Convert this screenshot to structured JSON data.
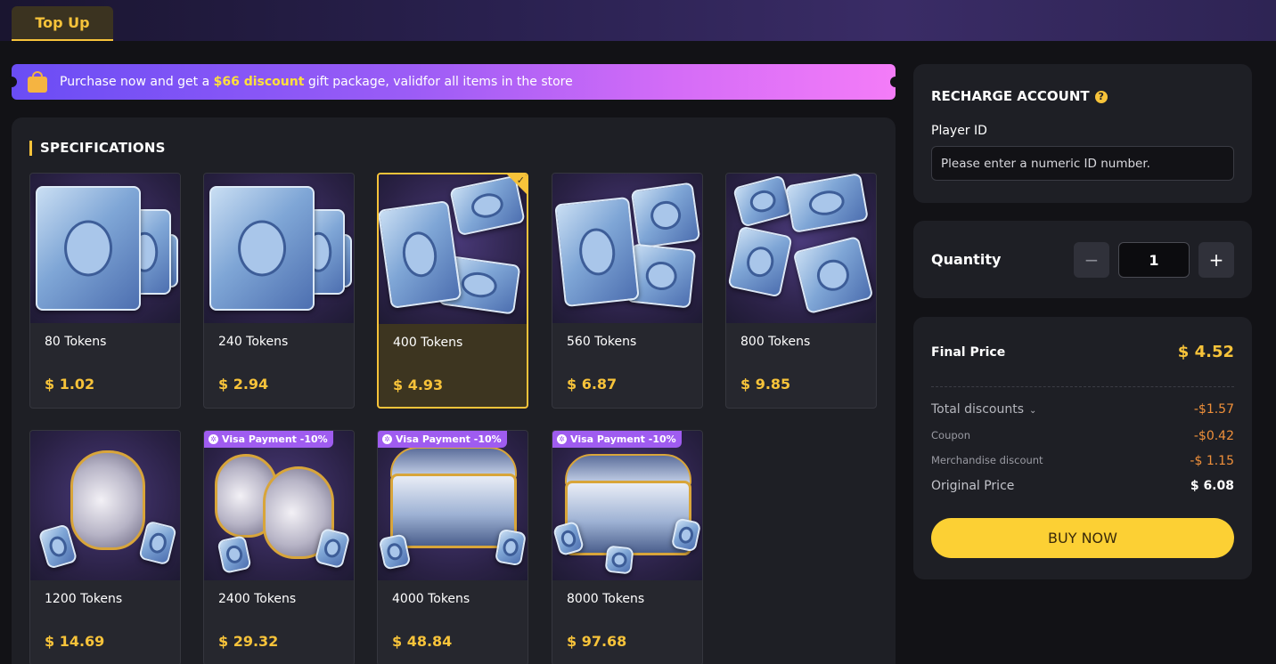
{
  "header": {
    "tab_label": "Top Up"
  },
  "banner": {
    "text_before": "Purchase now and get a ",
    "highlight": "$66 discount",
    "text_after": " gift package, validfor all items in the store"
  },
  "specs": {
    "title": "SPECIFICATIONS",
    "items": [
      {
        "name": "80 Tokens",
        "price": "$ 1.02",
        "selected": false,
        "badge": ""
      },
      {
        "name": "240 Tokens",
        "price": "$ 2.94",
        "selected": false,
        "badge": ""
      },
      {
        "name": "400 Tokens",
        "price": "$ 4.93",
        "selected": true,
        "badge": ""
      },
      {
        "name": "560 Tokens",
        "price": "$ 6.87",
        "selected": false,
        "badge": ""
      },
      {
        "name": "800 Tokens",
        "price": "$ 9.85",
        "selected": false,
        "badge": ""
      },
      {
        "name": "1200 Tokens",
        "price": "$ 14.69",
        "selected": false,
        "badge": ""
      },
      {
        "name": "2400 Tokens",
        "price": "$ 29.32",
        "selected": false,
        "badge": "Visa Payment -10%"
      },
      {
        "name": "4000 Tokens",
        "price": "$ 48.84",
        "selected": false,
        "badge": "Visa Payment -10%"
      },
      {
        "name": "8000 Tokens",
        "price": "$ 97.68",
        "selected": false,
        "badge": "Visa Payment -10%"
      }
    ]
  },
  "account": {
    "title": "RECHARGE ACCOUNT",
    "player_id_label": "Player ID",
    "player_id_placeholder": "Please enter a numeric ID number.",
    "player_id_value": ""
  },
  "quantity": {
    "label": "Quantity",
    "value": "1",
    "minus": "−",
    "plus": "+"
  },
  "summary": {
    "final_price_label": "Final Price",
    "final_price": "$ 4.52",
    "total_discounts_label": "Total discounts",
    "total_discounts": "-$1.57",
    "coupon_label": "Coupon",
    "coupon": "-$0.42",
    "merch_label": "Merchandise discount",
    "merch": "-$ 1.15",
    "original_label": "Original Price",
    "original": "$ 6.08",
    "buy_label": "BUY NOW"
  },
  "colors": {
    "accent": "#f7c33a",
    "badge": "#9f5cf0",
    "discount": "#f0903a"
  }
}
